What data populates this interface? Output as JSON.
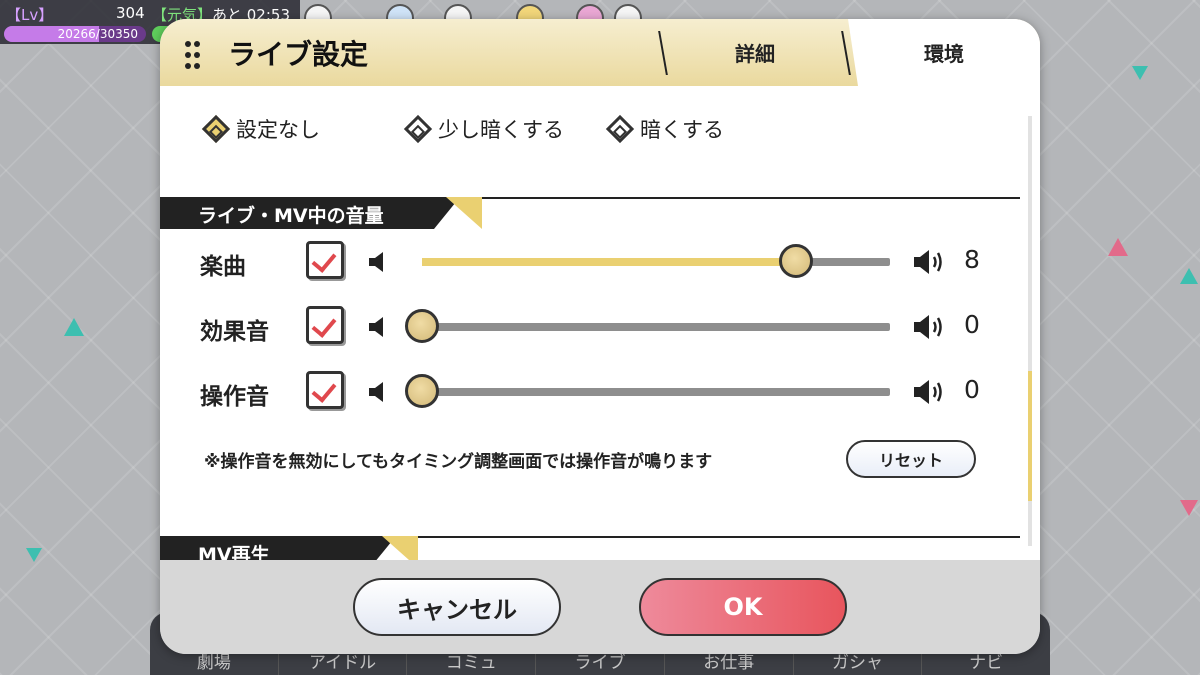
{
  "status": {
    "lv_label": "【Lv】",
    "lv_value": "304",
    "genki_label": "【元気】",
    "genki_timer": "あと 02:53",
    "exp_text": "20266/30350",
    "exp_progress": 0.668
  },
  "bottom_nav": [
    "劇場",
    "アイドル",
    "コミュ",
    "ライブ",
    "お仕事",
    "ガシャ",
    "ナビ"
  ],
  "dialog": {
    "title": "ライブ設定",
    "tabs": [
      {
        "label": "詳細",
        "active": false
      },
      {
        "label": "環境",
        "active": true
      }
    ],
    "brightness_options": [
      {
        "label": "設定なし",
        "selected": true
      },
      {
        "label": "少し暗くする",
        "selected": false
      },
      {
        "label": "暗くする",
        "selected": false
      }
    ],
    "volume_section_title": "ライブ・MV中の音量",
    "volumes": [
      {
        "label": "楽曲",
        "checked": true,
        "value": "8",
        "level": 0.8
      },
      {
        "label": "効果音",
        "checked": true,
        "value": "0",
        "level": 0.0
      },
      {
        "label": "操作音",
        "checked": true,
        "value": "0",
        "level": 0.0
      }
    ],
    "note": "※操作音を無効にしてもタイミング調整画面では操作音が鳴ります",
    "reset_label": "リセット",
    "mv_section_title": "MV再生",
    "cancel_label": "キャンセル",
    "ok_label": "OK"
  },
  "colors": {
    "accent_gold": "#ead071",
    "ok_red": "#e8555d",
    "check_red": "#e0484d",
    "header_dark": "#222222"
  }
}
